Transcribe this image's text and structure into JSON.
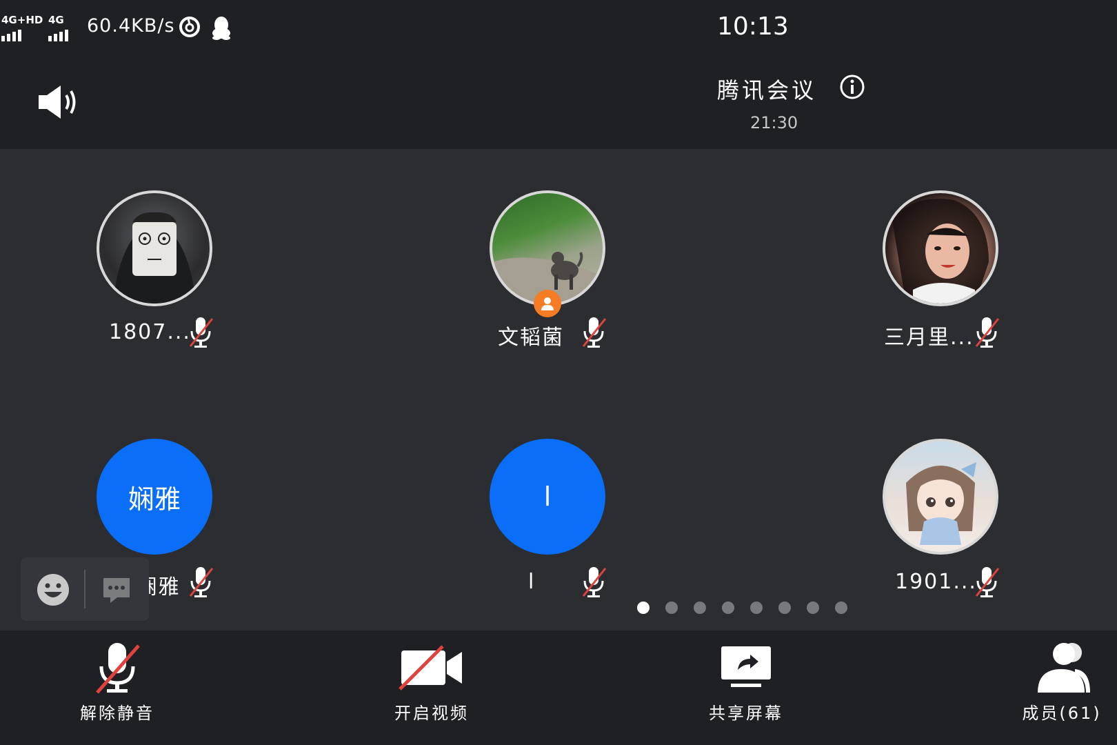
{
  "status_bar": {
    "signal_1": "4G+HD",
    "signal_2": "4G",
    "network_speed": "60.4KB/s",
    "time": "10:13",
    "icons": [
      "netease-music-icon",
      "qq-penguin-icon"
    ]
  },
  "header": {
    "title": "腾讯会议",
    "duration": "21:30",
    "speaker_icon": "speaker-icon",
    "info_icon": "info-icon"
  },
  "participants": [
    {
      "name": "1807...",
      "avatar_type": "photo",
      "muted": true
    },
    {
      "name": "文韬菌",
      "avatar_type": "photo",
      "muted": true,
      "host": true
    },
    {
      "name": "三月里...",
      "avatar_type": "photo",
      "muted": true
    },
    {
      "name": "佐.娴雅",
      "avatar_type": "initials",
      "initials": "娴雅",
      "muted": true
    },
    {
      "name": "l",
      "avatar_type": "initials",
      "initials": "l",
      "muted": true
    },
    {
      "name": "1901...",
      "avatar_type": "photo",
      "muted": true
    }
  ],
  "pagination": {
    "total_pages": 8,
    "current_page": 1
  },
  "toolbar": {
    "unmute": "解除静音",
    "video": "开启视频",
    "share": "共享屏幕",
    "members": "成员(61)"
  },
  "colors": {
    "background": "#2b2d31",
    "bar": "#1f2024",
    "avatar_blue": "#0a6ef9",
    "host_orange": "#f57c23",
    "mute_red": "#e0433d"
  }
}
